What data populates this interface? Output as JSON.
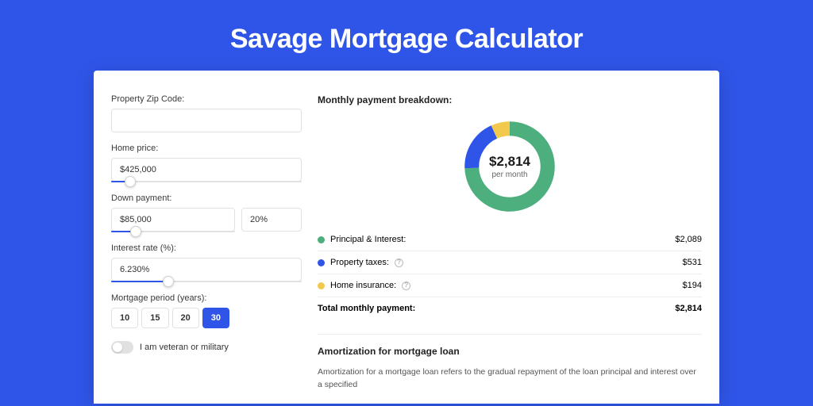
{
  "title": "Savage Mortgage Calculator",
  "form": {
    "zip_label": "Property Zip Code:",
    "zip_value": "",
    "home_price_label": "Home price:",
    "home_price_value": "$425,000",
    "home_price_slider_pct": 10,
    "down_payment_label": "Down payment:",
    "down_payment_value": "$85,000",
    "down_payment_pct_value": "20%",
    "down_payment_slider_pct": 20,
    "interest_label": "Interest rate (%):",
    "interest_value": "6.230%",
    "interest_slider_pct": 30,
    "period_label": "Mortgage period (years):",
    "periods": [
      "10",
      "15",
      "20",
      "30"
    ],
    "period_active_index": 3,
    "veteran_label": "I am veteran or military",
    "veteran_on": false
  },
  "breakdown": {
    "title": "Monthly payment breakdown:",
    "center_value": "$2,814",
    "center_sub": "per month",
    "items": [
      {
        "label": "Principal & Interest:",
        "value": "$2,089",
        "color": "#4caf7d",
        "info": false,
        "amount_num": 2089
      },
      {
        "label": "Property taxes:",
        "value": "$531",
        "color": "#2f55e8",
        "info": true,
        "amount_num": 531
      },
      {
        "label": "Home insurance:",
        "value": "$194",
        "color": "#f2c94c",
        "info": true,
        "amount_num": 194
      }
    ],
    "total_label": "Total monthly payment:",
    "total_value": "$2,814"
  },
  "amortization": {
    "title": "Amortization for mortgage loan",
    "text": "Amortization for a mortgage loan refers to the gradual repayment of the loan principal and interest over a specified"
  },
  "chart_data": {
    "type": "pie",
    "title": "Monthly payment breakdown",
    "series": [
      {
        "name": "Principal & Interest",
        "value": 2089,
        "color": "#4caf7d"
      },
      {
        "name": "Property taxes",
        "value": 531,
        "color": "#2f55e8"
      },
      {
        "name": "Home insurance",
        "value": 194,
        "color": "#f2c94c"
      }
    ],
    "total": 2814,
    "center_label": "$2,814 per month"
  }
}
